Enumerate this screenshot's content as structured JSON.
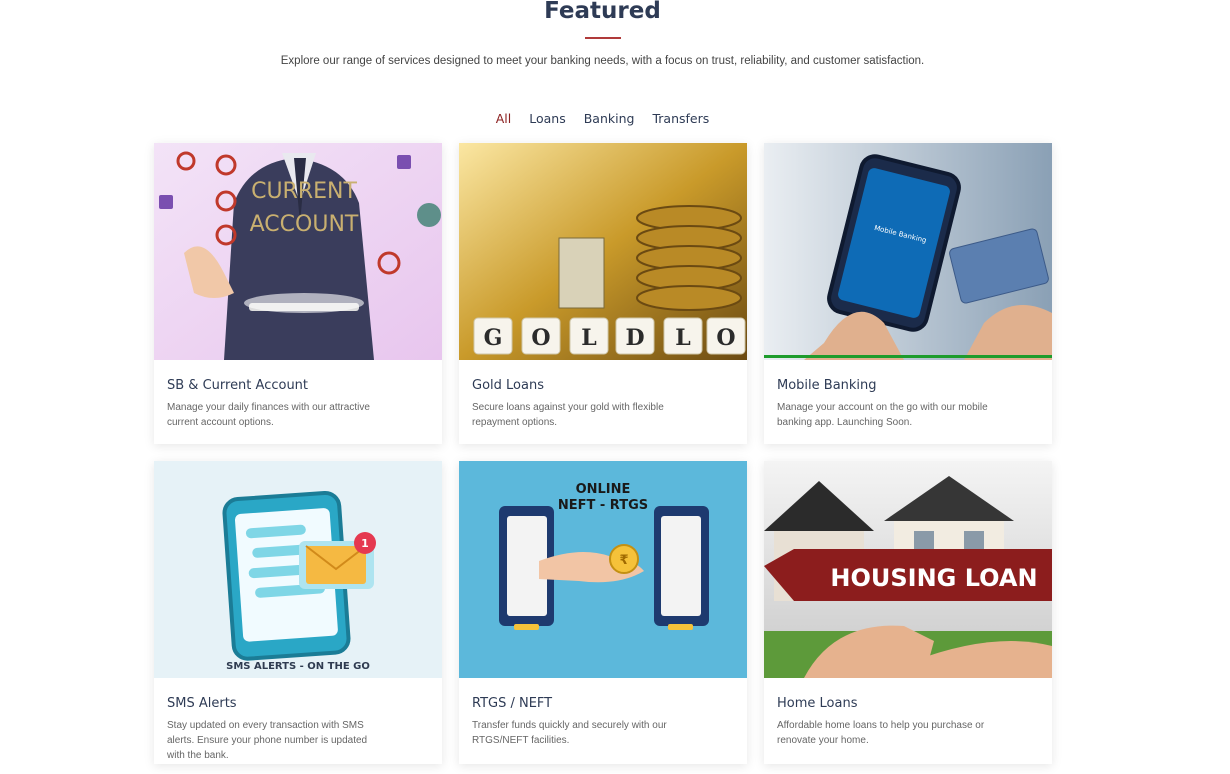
{
  "header": {
    "title": "Featured",
    "subtitle": "Explore our range of services designed to meet your banking needs, with a focus on trust, reliability, and customer satisfaction."
  },
  "filters": [
    {
      "label": "All",
      "active": true
    },
    {
      "label": "Loans",
      "active": false
    },
    {
      "label": "Banking",
      "active": false
    },
    {
      "label": "Transfers",
      "active": false
    }
  ],
  "cards": [
    {
      "title": "SB & Current Account",
      "desc": "Manage your daily finances with our attractive current account options.",
      "image_text": "CURRENT ACCOUNT"
    },
    {
      "title": "Gold Loans",
      "desc": "Secure loans against your gold with flexible repayment options.",
      "image_text": "GOLD LOAN"
    },
    {
      "title": "Mobile Banking",
      "desc": "Manage your account on the go with our mobile banking app. Launching Soon.",
      "image_text": "Mobile Banking"
    },
    {
      "title": "SMS Alerts",
      "desc": "Stay updated on every transaction with SMS alerts. Ensure your phone number is updated with the bank.",
      "image_text": "SMS ALERTS - ON THE GO"
    },
    {
      "title": "RTGS / NEFT",
      "desc": "Transfer funds quickly and securely with our RTGS/NEFT facilities.",
      "image_text": "ONLINE NEFT - RTGS"
    },
    {
      "title": "Home Loans",
      "desc": "Affordable home loans to help you purchase or renovate your home.",
      "image_text": "HOUSING LOAN"
    }
  ]
}
